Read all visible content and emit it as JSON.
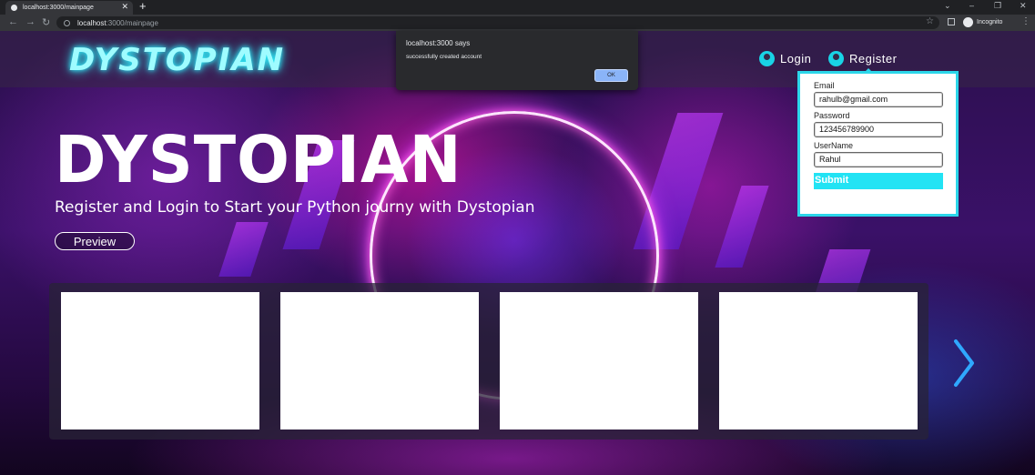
{
  "browser": {
    "tab_title": "localhost:3000/mainpage",
    "close_tab": "✕",
    "new_tab": "+",
    "url_host": "localhost",
    "url_rest": ":3000/mainpage",
    "incognito_label": "Incognito",
    "window_controls": {
      "minimize": "–",
      "restore": "❐",
      "close": "✕"
    },
    "chevron": "⌄",
    "nav": {
      "back": "←",
      "forward": "→",
      "reload": "↻"
    },
    "star": "☆",
    "menu": "⋮"
  },
  "site": {
    "logo": "DYSTOPIAN",
    "nav": {
      "login": "Login",
      "register": "Register"
    }
  },
  "hero": {
    "title": "DYSTOPIAN",
    "subtitle": "Register and Login to Start your Python journy with Dystopian",
    "preview_button": "Preview"
  },
  "register_form": {
    "email_label": "Email",
    "email_value": "rahulb@gmail.com",
    "password_label": "Password",
    "password_value": "123456789900",
    "username_label": "UserName",
    "username_value": "Rahul",
    "submit_label": "Submit"
  },
  "alert": {
    "title": "localhost:3000 says",
    "message": "successfully created account",
    "ok_label": "OK"
  },
  "colors": {
    "accent": "#22e3f4",
    "neon": "#9ffcff",
    "page_bg": "#3a1168"
  }
}
